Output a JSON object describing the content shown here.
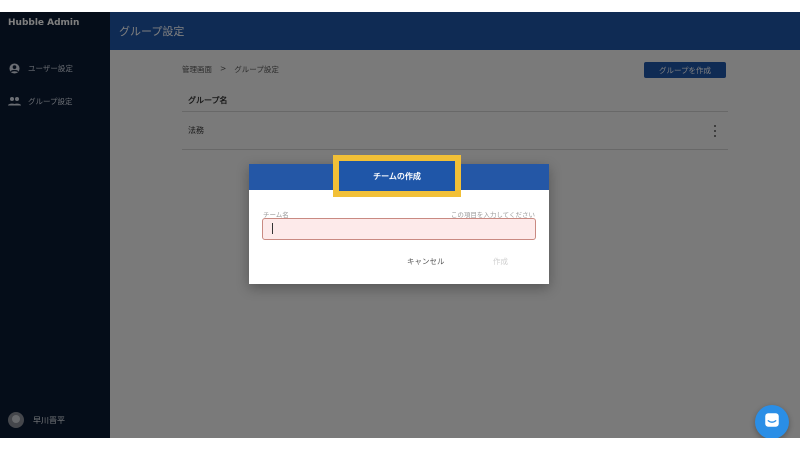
{
  "sidebar": {
    "brand": "Hubble Admin",
    "items": [
      {
        "label": "ユーザー設定",
        "icon": "account-circle-icon"
      },
      {
        "label": "グループ設定",
        "icon": "people-icon"
      }
    ],
    "user_name": "早川晋平"
  },
  "header": {
    "title": "グループ設定"
  },
  "main": {
    "breadcrumb": [
      "管理画面",
      ">",
      "グループ設定"
    ],
    "create_group_label": "グループを作成",
    "table_header": "グループ名",
    "rows": [
      {
        "name": "法務"
      }
    ]
  },
  "dialog": {
    "title": "チームの作成",
    "field_label": "チーム名",
    "field_hint": "この項目を入力してください",
    "field_value": "",
    "cancel_label": "キャンセル",
    "create_label": "作成"
  },
  "colors": {
    "sidebar": "#0b1a33",
    "primary": "#1f56a8",
    "highlight": "#f2c037",
    "chat": "#2a8ee6"
  }
}
